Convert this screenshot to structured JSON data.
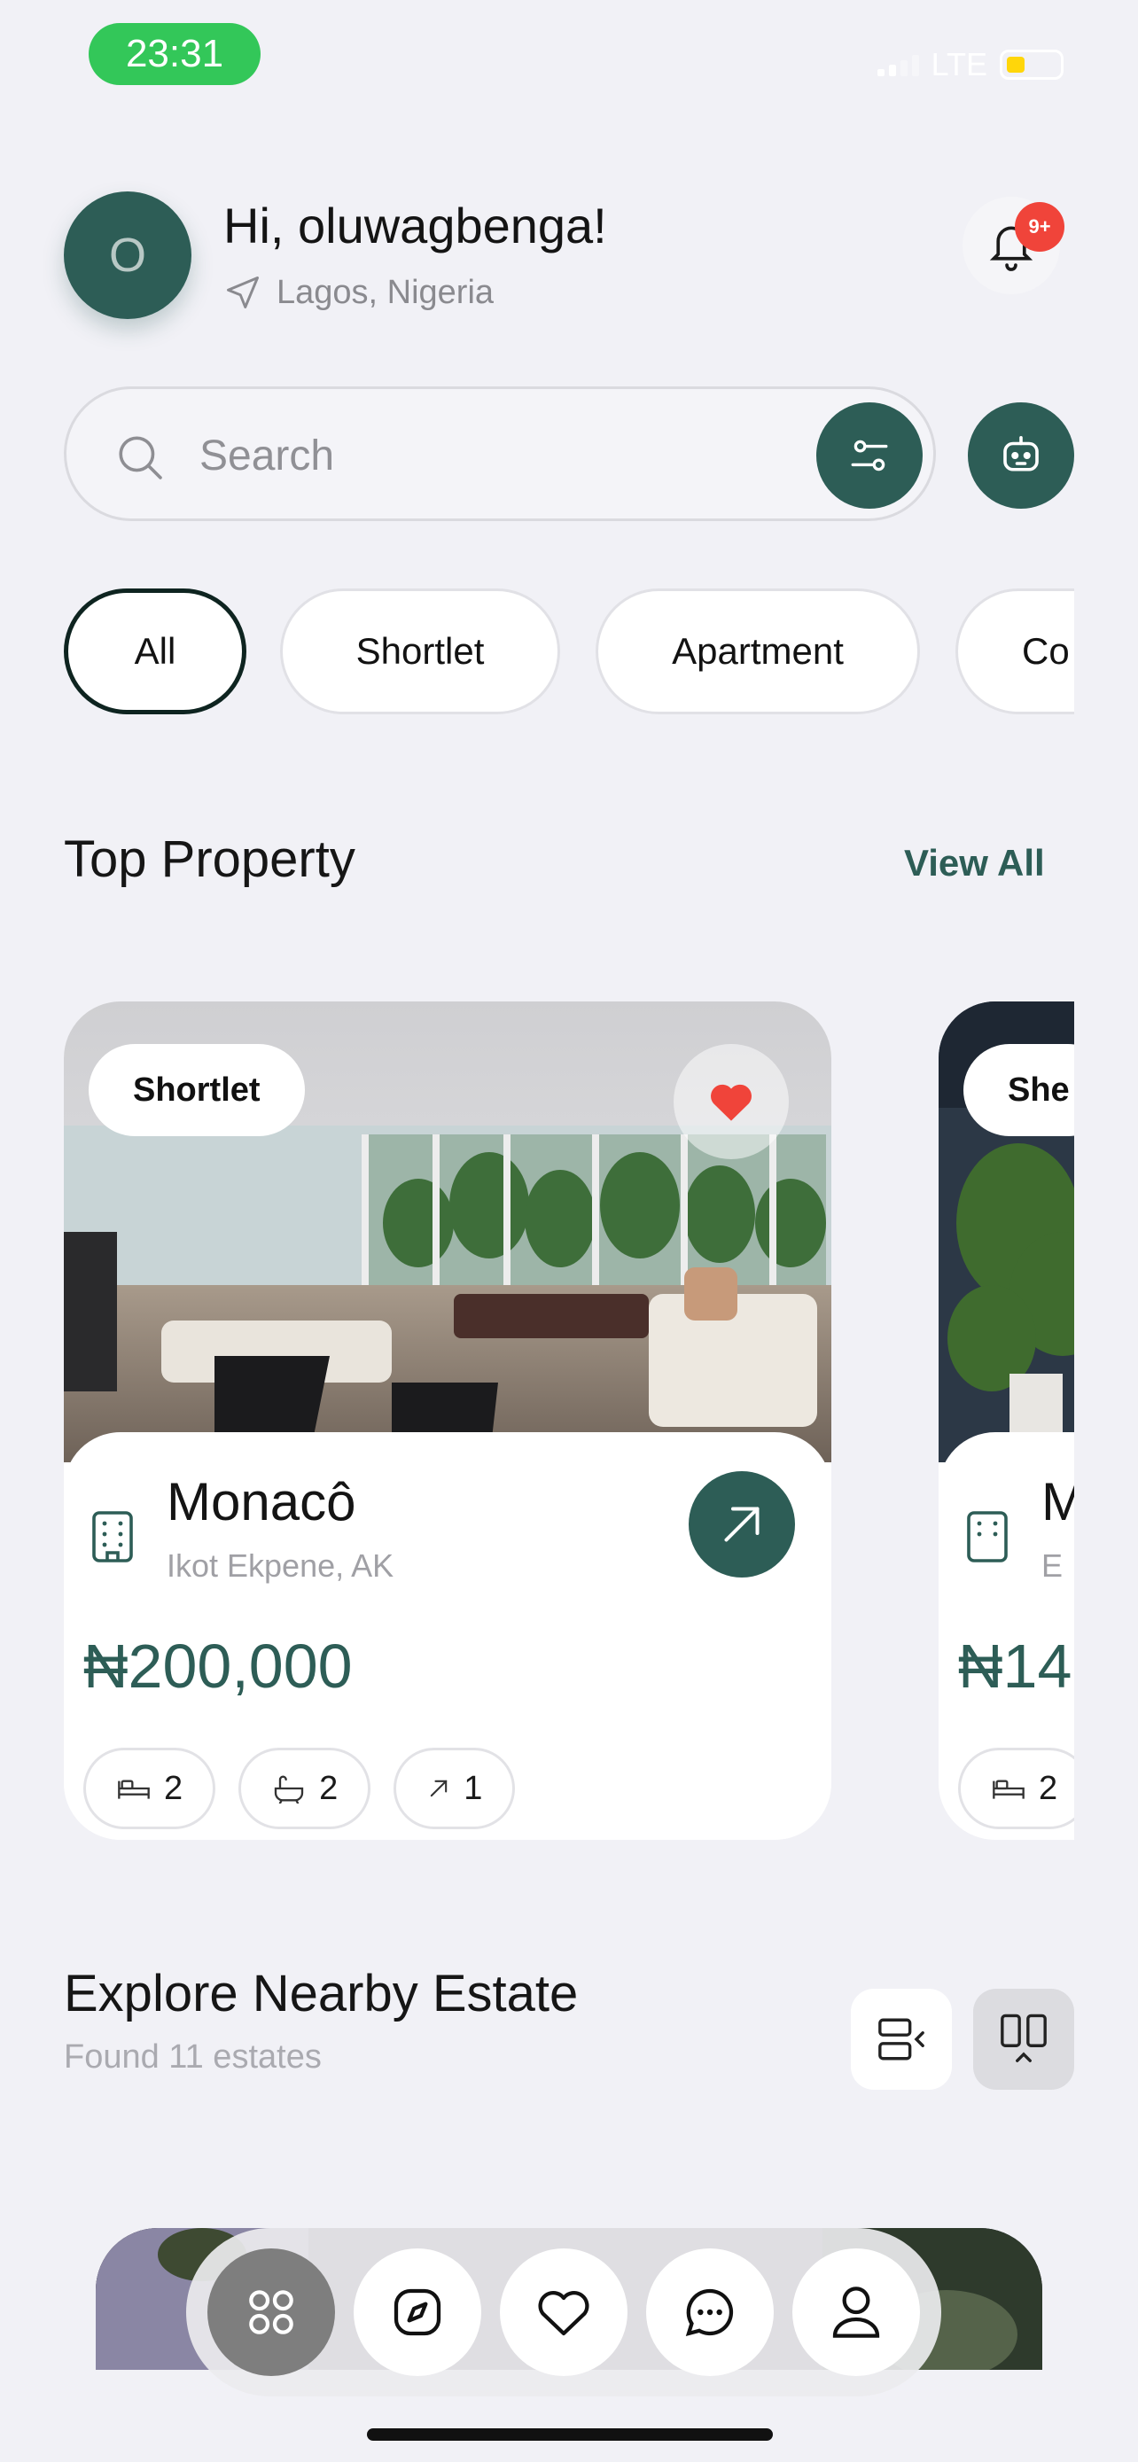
{
  "status_bar": {
    "time": "23:31",
    "network": "LTE"
  },
  "header": {
    "avatar_initial": "O",
    "greeting": "Hi, oluwagbenga!",
    "location": "Lagos, Nigeria",
    "notification_badge": "9+"
  },
  "search": {
    "placeholder": "Search"
  },
  "categories": [
    "All",
    "Shortlet",
    "Apartment",
    "Co"
  ],
  "top_property": {
    "title": "Top Property",
    "view_all": "View All"
  },
  "properties": [
    {
      "tag": "Shortlet",
      "name": "Monacô",
      "address": "Ikot Ekpene, AK",
      "price": "₦200,000",
      "beds": "2",
      "baths": "2",
      "size": "1",
      "favorited": true
    },
    {
      "tag": "She",
      "name": "M",
      "address": "E",
      "price": "₦14",
      "beds": "2"
    }
  ],
  "nearby": {
    "title": "Explore Nearby Estate",
    "subtitle": "Found 11 estates"
  },
  "nav": [
    "grid-icon",
    "compass-icon",
    "heart-icon",
    "chat-icon",
    "profile-icon"
  ],
  "colors": {
    "brand": "#2D5D56",
    "favorite": "#F0443A",
    "status_green": "#33C759",
    "badge": "#F0443A"
  }
}
